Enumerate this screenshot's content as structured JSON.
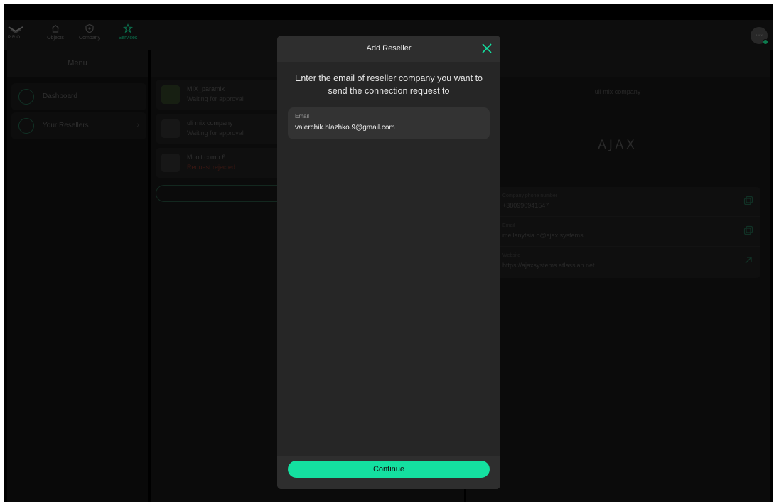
{
  "nav": {
    "brand_sub": "PRO",
    "items": [
      {
        "label": "Objects",
        "icon": "home-icon"
      },
      {
        "label": "Company",
        "icon": "shield-icon"
      },
      {
        "label": "Services",
        "icon": "star-icon"
      }
    ],
    "avatar_text": "AJAX",
    "accent": "#14e0a0"
  },
  "menu": {
    "title": "Menu",
    "items": [
      {
        "label": "Dashboard",
        "icon": "dashboard-icon"
      },
      {
        "label": "Your Resellers",
        "icon": "reseller-icon"
      }
    ]
  },
  "resellers": [
    {
      "name": "MIX_paramix",
      "status": "Waiting for approval"
    },
    {
      "name": "uli mix company",
      "status": "Waiting for approval"
    },
    {
      "name": "Moolt comp £",
      "status": "Request rejected"
    }
  ],
  "detail": {
    "company_name": "uli mix company",
    "logo_text": "AJAX",
    "fields": [
      {
        "label": "Company phone number",
        "value": "+380990941547",
        "action": "copy-icon"
      },
      {
        "label": "Email",
        "value": "mellanytsia.o@ajax.systems",
        "action": "copy-icon"
      },
      {
        "label": "Website",
        "value": "https://ajaxsystems.atlassian.net",
        "action": "external-link-icon"
      }
    ]
  },
  "modal": {
    "title": "Add Reseller",
    "prompt": "Enter the email of reseller company you want to send the connection request to",
    "email_label": "Email",
    "email_value": "valerchik.blazhko.9@gmail.com",
    "continue_label": "Continue"
  }
}
